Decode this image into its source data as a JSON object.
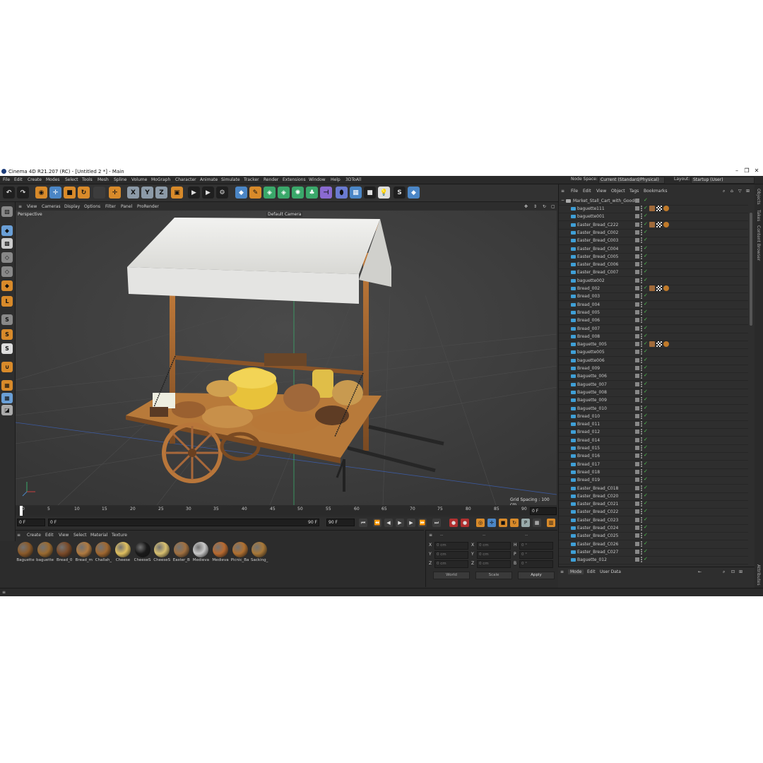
{
  "window": {
    "title": "Cinema 4D R21.207 (RC) - [Untitled 2 *] - Main",
    "controls": [
      "–",
      "❐",
      "✕"
    ]
  },
  "menubar": {
    "items": [
      "File",
      "Edit",
      "Create",
      "Modes",
      "Select",
      "Tools",
      "Mesh",
      "Spline",
      "Volume",
      "MoGraph",
      "Character",
      "Animate",
      "Simulate",
      "Tracker",
      "Render",
      "Extensions",
      "Window",
      "Help",
      "3DToAll"
    ],
    "node_space_label": "Node Space:",
    "node_space_value": "Current (Standard/Physical)",
    "layout_label": "Layout:",
    "layout_value": "Startup (User)"
  },
  "toolbar": {
    "axis_buttons": [
      "X",
      "Y",
      "Z"
    ]
  },
  "viewport": {
    "menu": [
      "View",
      "Cameras",
      "Display",
      "Options",
      "Filter",
      "Panel",
      "ProRender"
    ],
    "label": "Perspective",
    "camera": "Default Camera",
    "grid_spacing": "Grid Spacing : 100 cm"
  },
  "timeline": {
    "ticks": [
      "0",
      "5",
      "10",
      "15",
      "20",
      "25",
      "30",
      "35",
      "40",
      "45",
      "50",
      "55",
      "60",
      "65",
      "70",
      "75",
      "80",
      "85",
      "90"
    ],
    "current_frame": "0 F",
    "start": "0 F",
    "preview_start": "0 F",
    "preview_end": "90 F",
    "end": "90 F"
  },
  "materials": {
    "menu": [
      "Create",
      "Edit",
      "View",
      "Select",
      "Material",
      "Texture"
    ],
    "items": [
      {
        "label": "Baguette",
        "color": "#8a5a2a"
      },
      {
        "label": "baguette",
        "color": "#9a6a30"
      },
      {
        "label": "Bread_0",
        "color": "#7a4a28"
      },
      {
        "label": "Bread_m",
        "color": "#b07a40"
      },
      {
        "label": "Challah_",
        "color": "#a06830"
      },
      {
        "label": "Cheese",
        "color": "#e0c060"
      },
      {
        "label": "CheeseS",
        "color": "#1a1a1a"
      },
      {
        "label": "CheeseS",
        "color": "#d8c070"
      },
      {
        "label": "Easter_B",
        "color": "#a07040"
      },
      {
        "label": "Medieva",
        "color": "#c8c8c8"
      },
      {
        "label": "Medieva",
        "color": "#b86a30"
      },
      {
        "label": "Picnic_Ba",
        "color": "#b07030"
      },
      {
        "label": "Sacking_",
        "color": "#a87838"
      }
    ]
  },
  "coordinates": {
    "pos_labels": [
      "X",
      "Y",
      "Z"
    ],
    "size_labels": [
      "X",
      "Y",
      "Z"
    ],
    "rot_labels": [
      "H",
      "P",
      "B"
    ],
    "pos_values": [
      "0 cm",
      "0 cm",
      "0 cm"
    ],
    "size_values": [
      "0 cm",
      "0 cm",
      "0 cm"
    ],
    "rot_values": [
      "0 °",
      "0 °",
      "0 °"
    ],
    "world": "World",
    "scale": "Scale",
    "apply": "Apply",
    "headers": [
      "--",
      "--",
      "--"
    ]
  },
  "objects": {
    "menu": [
      "File",
      "Edit",
      "View",
      "Object",
      "Tags",
      "Bookmarks"
    ],
    "root": "Market_Stall_Cart_with_Goods",
    "items": [
      {
        "name": "baguette111",
        "tags": true
      },
      {
        "name": "baguette001",
        "tags": false
      },
      {
        "name": "Easter_Bread_C222",
        "tags": true
      },
      {
        "name": "Easter_Bread_C002",
        "tags": false
      },
      {
        "name": "Easter_Bread_C003",
        "tags": false
      },
      {
        "name": "Easter_Bread_C004",
        "tags": false
      },
      {
        "name": "Easter_Bread_C005",
        "tags": false
      },
      {
        "name": "Easter_Bread_C006",
        "tags": false
      },
      {
        "name": "Easter_Bread_C007",
        "tags": false
      },
      {
        "name": "baguette002",
        "tags": false
      },
      {
        "name": "Bread_002",
        "tags": true
      },
      {
        "name": "Bread_003",
        "tags": false
      },
      {
        "name": "Bread_004",
        "tags": false
      },
      {
        "name": "Bread_005",
        "tags": false
      },
      {
        "name": "Bread_006",
        "tags": false
      },
      {
        "name": "Bread_007",
        "tags": false
      },
      {
        "name": "Bread_008",
        "tags": false
      },
      {
        "name": "Baguette_005",
        "tags": true
      },
      {
        "name": "baguette005",
        "tags": false
      },
      {
        "name": "baguette006",
        "tags": false
      },
      {
        "name": "Bread_009",
        "tags": false
      },
      {
        "name": "Baguette_006",
        "tags": false
      },
      {
        "name": "Baguette_007",
        "tags": false
      },
      {
        "name": "Baguette_008",
        "tags": false
      },
      {
        "name": "Baguette_009",
        "tags": false
      },
      {
        "name": "Baguette_010",
        "tags": false
      },
      {
        "name": "Bread_010",
        "tags": false
      },
      {
        "name": "Bread_011",
        "tags": false
      },
      {
        "name": "Bread_012",
        "tags": false
      },
      {
        "name": "Bread_014",
        "tags": false
      },
      {
        "name": "Bread_015",
        "tags": false
      },
      {
        "name": "Bread_016",
        "tags": false
      },
      {
        "name": "Bread_017",
        "tags": false
      },
      {
        "name": "Bread_018",
        "tags": false
      },
      {
        "name": "Bread_019",
        "tags": false
      },
      {
        "name": "Easter_Bread_C018",
        "tags": false
      },
      {
        "name": "Easter_Bread_C020",
        "tags": false
      },
      {
        "name": "Easter_Bread_C021",
        "tags": false
      },
      {
        "name": "Easter_Bread_C022",
        "tags": false
      },
      {
        "name": "Easter_Bread_C023",
        "tags": false
      },
      {
        "name": "Easter_Bread_C024",
        "tags": false
      },
      {
        "name": "Easter_Bread_C025",
        "tags": false
      },
      {
        "name": "Easter_Bread_C026",
        "tags": false
      },
      {
        "name": "Easter_Bread_C027",
        "tags": false
      },
      {
        "name": "Baguette_012",
        "tags": false
      }
    ]
  },
  "attributes": {
    "tabs": [
      "Mode",
      "Edit",
      "User Data"
    ]
  },
  "sidetabs": [
    "Objects",
    "Takes",
    "Content Browser",
    "Attributes"
  ]
}
